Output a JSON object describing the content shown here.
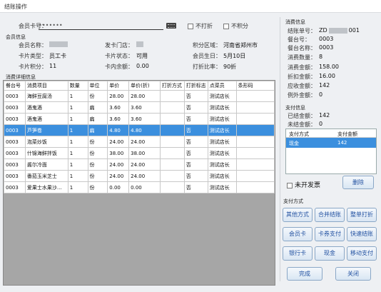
{
  "window": {
    "title": "结账操作"
  },
  "card_search": {
    "label": "会员卡号：",
    "value": "•••••••",
    "no_discount_label": "不打折",
    "no_points_label": "不积分"
  },
  "member_info": {
    "section_title": "会员信息",
    "name_label": "会员名称：",
    "issue_store_label": "发卡门店：",
    "region_label": "积分区域：",
    "region_value": "河南省郑州市",
    "card_type_label": "卡片类型：",
    "card_type_value": "员工卡",
    "card_status_label": "卡片状态：",
    "card_status_value": "可用",
    "birthday_label": "会员生日：",
    "birthday_value": "5月10日",
    "points_label": "卡片积分：",
    "points_value": "11",
    "balance_label": "卡内余额：",
    "balance_value": "0.00",
    "discount_label": "打折比率：",
    "discount_value": "90折"
  },
  "consumption": {
    "section_title": "消费详细信息",
    "columns": [
      "餐台号",
      "消费项目",
      "数量",
      "单位",
      "单价",
      "单价(折)",
      "打折方式",
      "打折标志",
      "点菜员",
      "条形码"
    ],
    "rows": [
      [
        "0003",
        "海鲜豆腐汤",
        "1",
        "份",
        "28.00",
        "28.00",
        "",
        "否",
        "测试店长",
        ""
      ],
      [
        "0003",
        "酒鬼酒",
        "1",
        "扁",
        "3.60",
        "3.60",
        "",
        "否",
        "测试店长",
        ""
      ],
      [
        "0003",
        "酒鬼酒",
        "1",
        "扁",
        "3.60",
        "3.60",
        "",
        "否",
        "测试店长",
        ""
      ],
      [
        "0003",
        "芦笋卷",
        "1",
        "扁",
        "4.80",
        "4.80",
        "",
        "否",
        "测试店长",
        ""
      ],
      [
        "0003",
        "泡菜炒饭",
        "1",
        "份",
        "24.00",
        "24.00",
        "",
        "否",
        "测试店长",
        ""
      ],
      [
        "0003",
        "什锦海鲜拌饭",
        "1",
        "份",
        "38.00",
        "38.00",
        "",
        "否",
        "测试店长",
        ""
      ],
      [
        "0003",
        "酱尔冷面",
        "1",
        "份",
        "24.00",
        "24.00",
        "",
        "否",
        "测试店长",
        ""
      ],
      [
        "0003",
        "番茄玉米芝士",
        "1",
        "份",
        "24.00",
        "24.00",
        "",
        "否",
        "测试店长",
        ""
      ],
      [
        "0003",
        "爱果士水果沙...",
        "1",
        "份",
        "0.00",
        "0.00",
        "",
        "否",
        "测试店长",
        ""
      ]
    ],
    "selected_row": 3
  },
  "bill_info": {
    "section_title": "消费信息",
    "bill_no_label": "结账单号：",
    "bill_no_value": "ZD",
    "bill_no_suffix": "001",
    "table_no_label": "餐台号：",
    "table_no_value": "0003",
    "table_name_label": "餐台名称：",
    "table_name_value": "0003",
    "qty_label": "消费数量：",
    "qty_value": "8",
    "amount_label": "消费金额：",
    "amount_value": "158.00",
    "discount_amt_label": "折扣金额：",
    "discount_amt_value": "16.00",
    "receivable_label": "应收金额：",
    "receivable_value": "142",
    "zero_label": "例外金额：",
    "zero_value": "0"
  },
  "payment_info": {
    "section_title": "支付信息",
    "paid_label": "已结金额：",
    "paid_value": "142",
    "unpaid_label": "未结金额：",
    "unpaid_value": "0",
    "col_method": "支付方式",
    "col_amount": "支付金额",
    "rows": [
      [
        "现金",
        "142"
      ]
    ]
  },
  "invoice": {
    "label": "未开发票",
    "delete_label": "删除"
  },
  "payment_methods": {
    "section_title": "支付方式",
    "buttons": [
      "其他方式",
      "合并结账",
      "整单打折",
      "会员卡",
      "卡券支付",
      "快速结账",
      "银行卡",
      "现金",
      "移动支付"
    ],
    "complete_label": "完成",
    "close_label": "关闭"
  }
}
